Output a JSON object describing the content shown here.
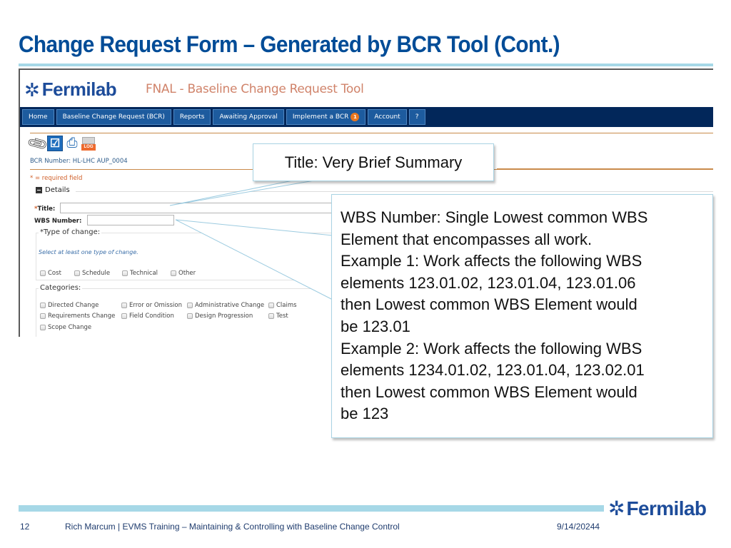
{
  "slide": {
    "title": "Change Request Form – Generated by BCR Tool (Cont.)",
    "footer": {
      "page_number": "12",
      "caption": "Rich Marcum | EVMS Training – Maintaining & Controlling with Baseline Change Control",
      "date": "9/14/20244",
      "logo_text": "Fermilab"
    }
  },
  "app": {
    "logo_text": "Fermilab",
    "title": "FNAL - Baseline Change Request Tool",
    "nav": [
      {
        "label": "Home"
      },
      {
        "label": "Baseline Change Request (BCR)"
      },
      {
        "label": "Reports"
      },
      {
        "label": "Awaiting Approval"
      },
      {
        "label": "Implement a BCR",
        "badge": "1"
      },
      {
        "label": "Account"
      },
      {
        "label": "?"
      }
    ],
    "toolbar_icons": [
      "paperclip-icon",
      "checkbox-icon",
      "printer-icon",
      "log-icon"
    ],
    "toolbar_log_label": "LOG",
    "bcr_number": "BCR Number: HL-LHC AUP_0004",
    "required_note": "* = required field",
    "details_label": "Details",
    "form": {
      "title_label": "Title:",
      "title_value": "",
      "wbs_label": "WBS Number:",
      "wbs_value": "",
      "required_star": "*",
      "type_of_change_legend": "*Type of change:",
      "type_of_change_hint": "Select at least one type of change.",
      "type_of_change_options": [
        "Cost",
        "Schedule",
        "Technical",
        "Other"
      ],
      "categories_legend": "Categories:",
      "categories_options": [
        "Directed Change",
        "Error or Omission",
        "Administrative Change",
        "Claims",
        "Requirements Change",
        "Field Condition",
        "Design Progression",
        "Test",
        "Scope Change"
      ]
    }
  },
  "callouts": {
    "title": "Title: Very Brief Summary",
    "wbs_lines": [
      "WBS Number: Single Lowest common WBS",
      "Element that encompasses all work.",
      "Example 1: Work affects the following WBS",
      "elements 123.01.02, 123.01.04, 123.01.06",
      "then Lowest common WBS Element would",
      "be 123.01",
      "Example 2: Work affects the following WBS",
      "elements 1234.01.02, 123.01.04, 123.02.01",
      "then Lowest common WBS Element would",
      "be 123"
    ]
  },
  "colors": {
    "title_blue": "#004c97",
    "nav_bg": "#02275a",
    "nav_button": "#1d5b9e",
    "accent_light_blue": "#a6d8e7",
    "badge_orange": "#e8761e",
    "app_title_salmon": "#d0836a"
  }
}
